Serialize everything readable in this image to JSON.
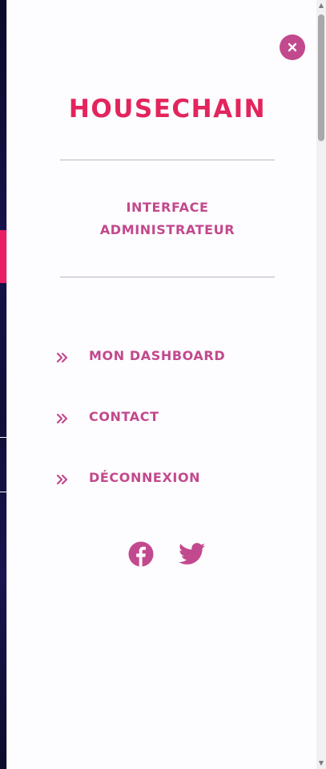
{
  "menu": {
    "brand": "HOUSECHAIN",
    "subtitle_line1": "INTERFACE",
    "subtitle_line2": "ADMINISTRATEUR",
    "close_symbol": "×",
    "items": [
      {
        "label": "MON DASHBOARD",
        "icon": "double-chevron-right-icon"
      },
      {
        "label": "CONTACT",
        "icon": "double-chevron-right-icon"
      },
      {
        "label": "DÉCONNEXION",
        "icon": "double-chevron-right-icon"
      }
    ],
    "social": [
      {
        "name": "facebook",
        "icon": "facebook-icon"
      },
      {
        "name": "twitter",
        "icon": "twitter-icon"
      }
    ]
  },
  "colors": {
    "accent": "#c2498d",
    "brand": "#e3245d",
    "panel_bg": "#fdfcfe",
    "divider": "#b8b4c6",
    "page_bg": "#0e0c2e"
  }
}
